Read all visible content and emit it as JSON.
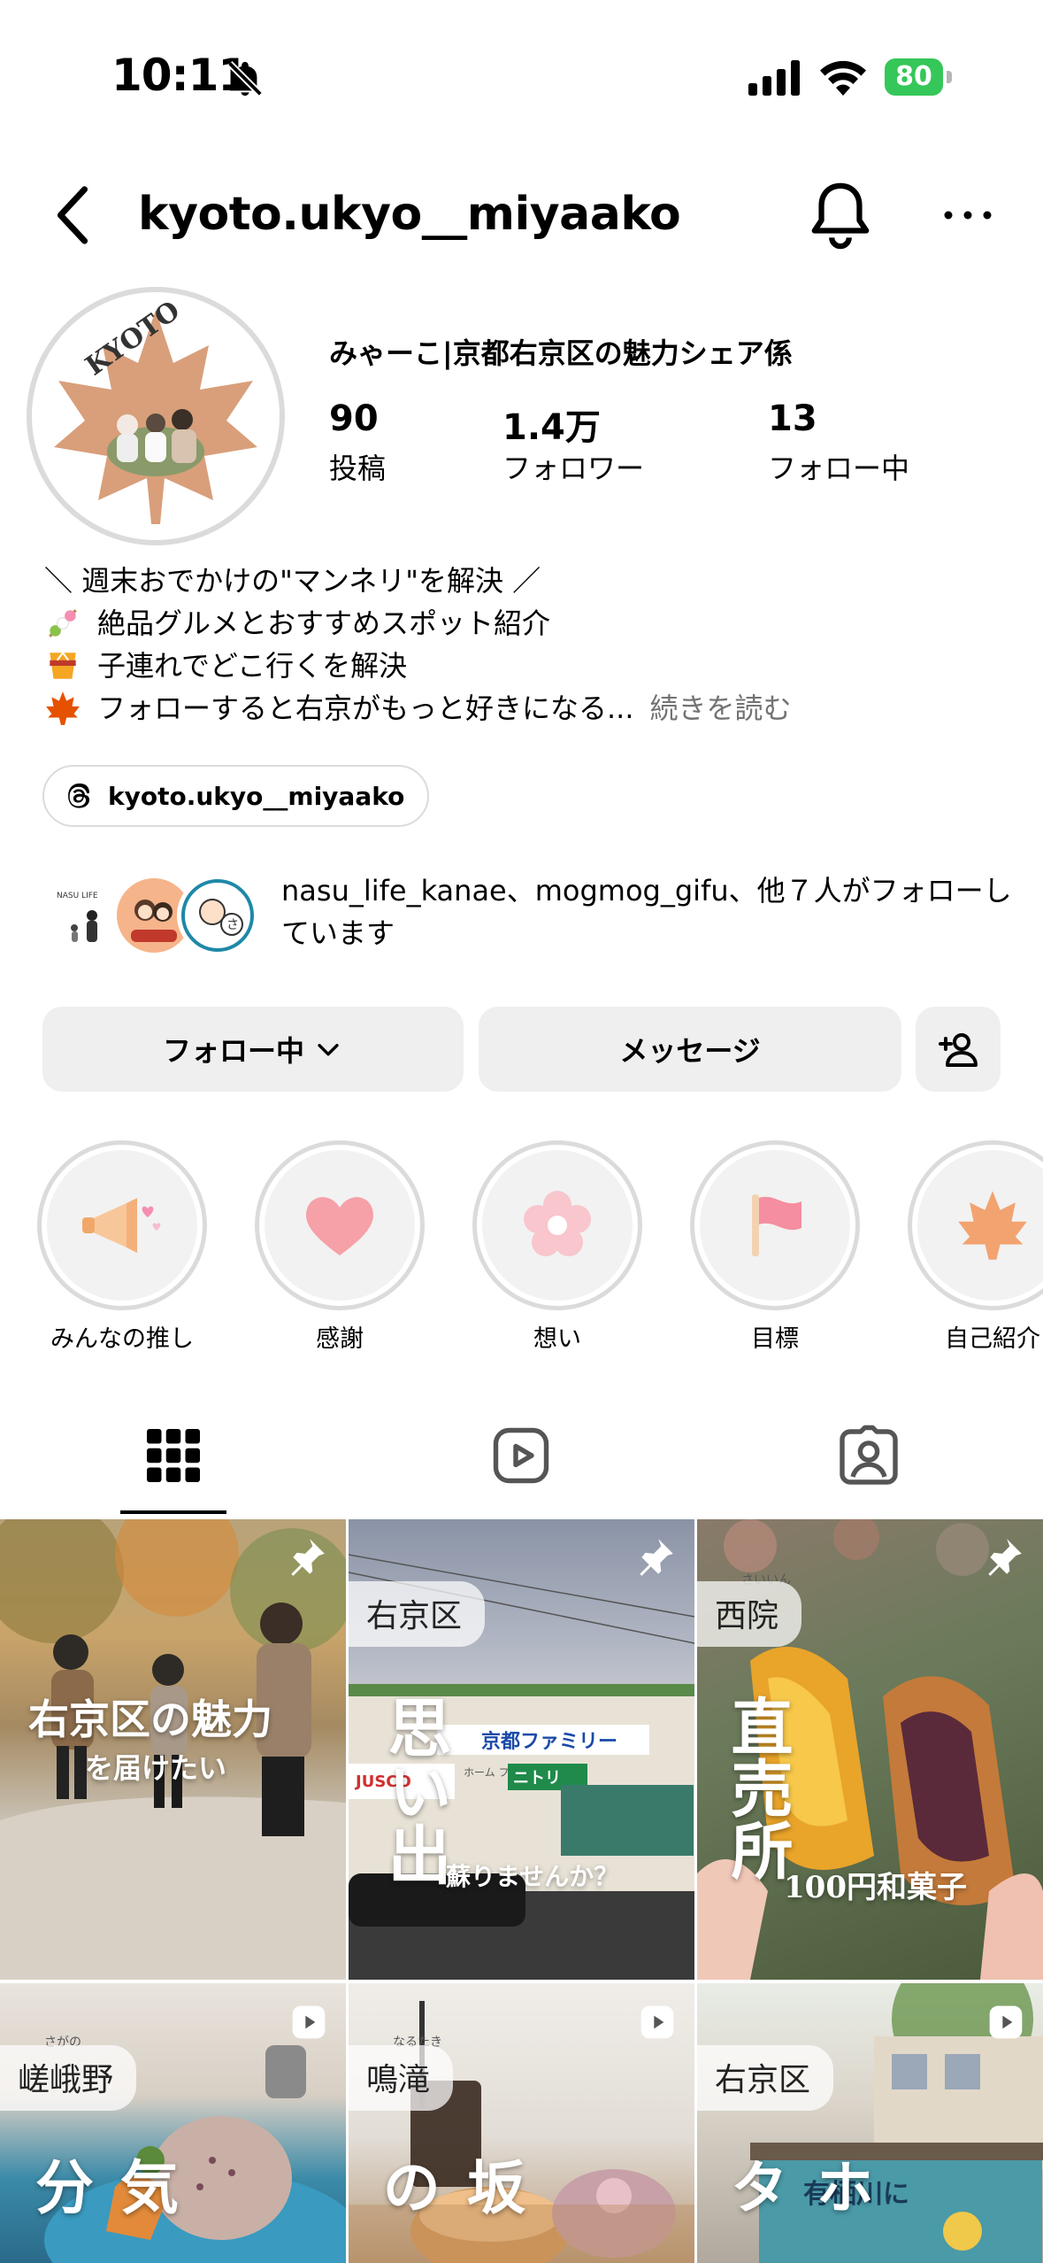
{
  "status_bar": {
    "time": "10:11",
    "battery": "80"
  },
  "header": {
    "username": "kyoto.ukyo__miyaako"
  },
  "profile": {
    "avatar_text": "KYOTO",
    "display_name": "みゃーこ|京都右京区の魅力シェア係",
    "stats": [
      {
        "value": "90",
        "label": "投稿"
      },
      {
        "value": "1.4万",
        "label": "フォロワー"
      },
      {
        "value": "13",
        "label": "フォロー中"
      }
    ],
    "bio": [
      "＼ 週末おでかけの\"マンネリ\"を解決 ／",
      "絶品グルメとおすすめスポット紹介",
      "子連れでどこ行くを解決",
      "フォローすると右京がもっと好きになる..."
    ],
    "bio_more": "続きを読む",
    "threads_handle": "kyoto.ukyo__miyaako",
    "followed_by": "nasu_life_kanae、mogmog_gifu、他７人がフォローしています",
    "followed_avatar_text": "NASU LIFE"
  },
  "actions": {
    "following": "フォロー中",
    "message": "メッセージ"
  },
  "highlights": [
    {
      "label": "みんなの推し",
      "icon": "megaphone-icon"
    },
    {
      "label": "感謝",
      "icon": "heart-icon"
    },
    {
      "label": "想い",
      "icon": "flower-icon"
    },
    {
      "label": "目標",
      "icon": "flag-icon"
    },
    {
      "label": "自己紹介",
      "icon": "maple-leaf-icon"
    }
  ],
  "posts": [
    {
      "line1": "右京区の魅力",
      "line2": "を届けたい",
      "type": "pinned"
    },
    {
      "tag": "右京区",
      "big": "思い出",
      "sub": "蘇りませんか？",
      "sign1": "京都ファミリー",
      "sign2": "ニトリ",
      "sign3": "JUSCO",
      "sign4": "ホーム ファッション",
      "type": "pinned"
    },
    {
      "ruby": "さいいん",
      "tag": "西院",
      "big": "直売所",
      "sub": "100円和菓子",
      "type": "pinned"
    },
    {
      "ruby": "さがの",
      "tag": "嵯峨野",
      "big": "気分",
      "type": "reel"
    },
    {
      "ruby": "なるたき",
      "tag": "鳴滝",
      "big": "坂の",
      "type": "reel"
    },
    {
      "tag": "右京区",
      "big": "ホタ",
      "sign": "有栖川に",
      "type": "reel"
    }
  ],
  "colors": {
    "accent_green": "#35c759",
    "button_bg": "#efefef",
    "muted_text": "#737373"
  }
}
